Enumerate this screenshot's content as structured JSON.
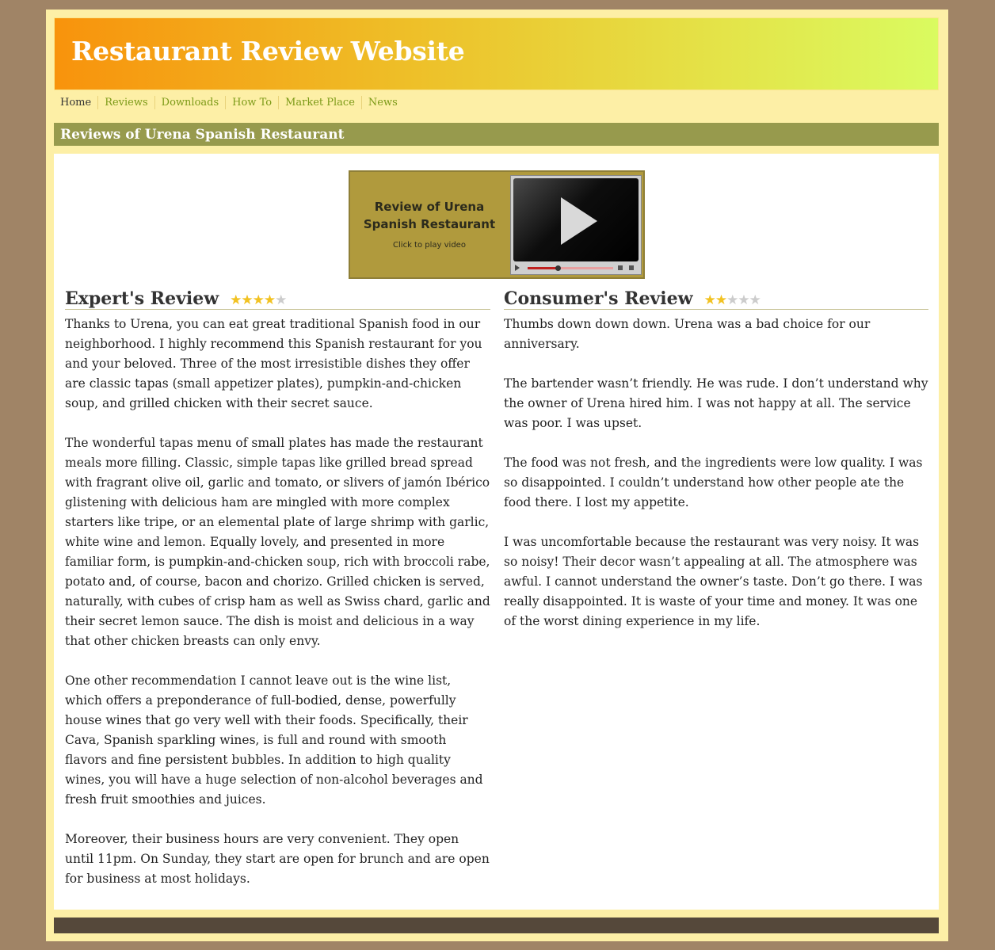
{
  "site": {
    "title": "Restaurant Review Website"
  },
  "nav": {
    "items": [
      "Home",
      "Reviews",
      "Downloads",
      "How To",
      "Market Place",
      "News"
    ]
  },
  "section": {
    "title": "Reviews of Urena Spanish Restaurant"
  },
  "video": {
    "title_line1": "Review of Urena",
    "title_line2": "Spanish Restaurant",
    "subtitle": "Click to play video",
    "progress": 0.35
  },
  "expert": {
    "heading": "Expert's Review",
    "rating": 4,
    "max_rating": 5,
    "paragraphs": [
      "Thanks to Urena, you can eat great traditional Spanish food in our neighborhood. I highly recommend this Spanish restaurant for you and your beloved. Three of the most irresistible dishes they offer are classic tapas (small appetizer plates), pumpkin-and-chicken soup, and grilled chicken with their secret sauce.",
      "The wonderful tapas menu of small plates has made the restaurant meals more filling. Classic, simple tapas like grilled bread spread with fragrant olive oil, garlic and tomato, or slivers of jamón Ibérico glistening with delicious ham are mingled with more complex starters like tripe, or an elemental plate of large shrimp with garlic, white wine and lemon. Equally lovely, and presented in more familiar form, is pumpkin-and-chicken soup, rich with broccoli rabe, potato and, of course, bacon and chorizo. Grilled chicken is served, naturally, with cubes of crisp ham as well as Swiss chard, garlic and their secret lemon sauce. The dish is moist and delicious in a way that other chicken breasts can only envy.",
      "One other recommendation I cannot leave out is the wine list, which offers a preponderance of full-bodied, dense, powerfully house wines that go very well with their foods. Specifically, their Cava, Spanish sparkling wines, is full and round with smooth flavors and fine persistent bubbles. In addition to high quality wines, you will have a huge selection of non-alcohol beverages and fresh fruit smoothies and juices.",
      "Moreover, their business hours are very convenient. They open until 11pm. On Sunday, they start are open for brunch and are open for business at most holidays."
    ]
  },
  "consumer": {
    "heading": "Consumer's Review",
    "rating": 2,
    "max_rating": 5,
    "paragraphs": [
      "Thumbs down down down. Urena was a bad choice for our anniversary.",
      "The bartender wasn’t friendly. He was rude. I don’t understand why the owner of Urena hired him. I was not happy at all. The service was poor. I was upset.",
      "The food was not fresh, and the ingredients were low quality. I was so disappointed. I couldn’t understand how other people ate the food there. I lost my appetite.",
      "I was uncomfortable because the restaurant was very noisy. It was so noisy! Their decor wasn’t appealing at all. The atmosphere was awful. I cannot understand the owner’s taste. Don’t go there. I was really disappointed. It is waste of your time and money. It was one of the worst dining experience in my life."
    ]
  },
  "colors": {
    "page_bg": "#a08466",
    "frame_bg": "#fdefa6",
    "section_bar": "#979a4d",
    "star_on": "#f2c222",
    "star_off": "#cccccc",
    "footer": "#55483a"
  }
}
